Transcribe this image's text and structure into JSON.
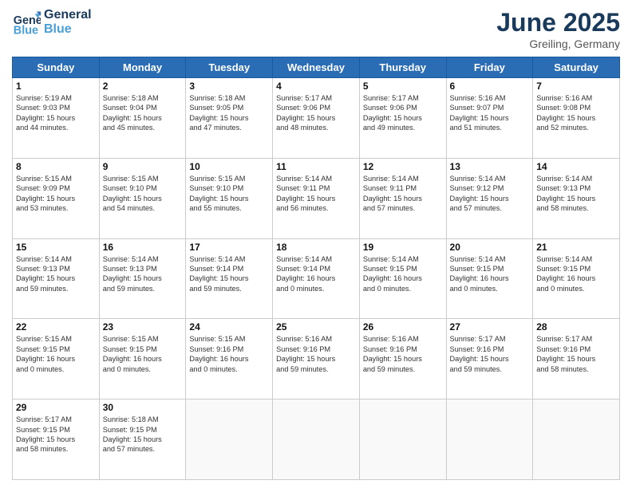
{
  "logo": {
    "line1": "General",
    "line2": "Blue"
  },
  "title": "June 2025",
  "location": "Greiling, Germany",
  "days_header": [
    "Sunday",
    "Monday",
    "Tuesday",
    "Wednesday",
    "Thursday",
    "Friday",
    "Saturday"
  ],
  "weeks": [
    [
      {
        "day": "1",
        "lines": [
          "Sunrise: 5:19 AM",
          "Sunset: 9:03 PM",
          "Daylight: 15 hours",
          "and 44 minutes."
        ]
      },
      {
        "day": "2",
        "lines": [
          "Sunrise: 5:18 AM",
          "Sunset: 9:04 PM",
          "Daylight: 15 hours",
          "and 45 minutes."
        ]
      },
      {
        "day": "3",
        "lines": [
          "Sunrise: 5:18 AM",
          "Sunset: 9:05 PM",
          "Daylight: 15 hours",
          "and 47 minutes."
        ]
      },
      {
        "day": "4",
        "lines": [
          "Sunrise: 5:17 AM",
          "Sunset: 9:06 PM",
          "Daylight: 15 hours",
          "and 48 minutes."
        ]
      },
      {
        "day": "5",
        "lines": [
          "Sunrise: 5:17 AM",
          "Sunset: 9:06 PM",
          "Daylight: 15 hours",
          "and 49 minutes."
        ]
      },
      {
        "day": "6",
        "lines": [
          "Sunrise: 5:16 AM",
          "Sunset: 9:07 PM",
          "Daylight: 15 hours",
          "and 51 minutes."
        ]
      },
      {
        "day": "7",
        "lines": [
          "Sunrise: 5:16 AM",
          "Sunset: 9:08 PM",
          "Daylight: 15 hours",
          "and 52 minutes."
        ]
      }
    ],
    [
      {
        "day": "8",
        "lines": [
          "Sunrise: 5:15 AM",
          "Sunset: 9:09 PM",
          "Daylight: 15 hours",
          "and 53 minutes."
        ]
      },
      {
        "day": "9",
        "lines": [
          "Sunrise: 5:15 AM",
          "Sunset: 9:10 PM",
          "Daylight: 15 hours",
          "and 54 minutes."
        ]
      },
      {
        "day": "10",
        "lines": [
          "Sunrise: 5:15 AM",
          "Sunset: 9:10 PM",
          "Daylight: 15 hours",
          "and 55 minutes."
        ]
      },
      {
        "day": "11",
        "lines": [
          "Sunrise: 5:14 AM",
          "Sunset: 9:11 PM",
          "Daylight: 15 hours",
          "and 56 minutes."
        ]
      },
      {
        "day": "12",
        "lines": [
          "Sunrise: 5:14 AM",
          "Sunset: 9:11 PM",
          "Daylight: 15 hours",
          "and 57 minutes."
        ]
      },
      {
        "day": "13",
        "lines": [
          "Sunrise: 5:14 AM",
          "Sunset: 9:12 PM",
          "Daylight: 15 hours",
          "and 57 minutes."
        ]
      },
      {
        "day": "14",
        "lines": [
          "Sunrise: 5:14 AM",
          "Sunset: 9:13 PM",
          "Daylight: 15 hours",
          "and 58 minutes."
        ]
      }
    ],
    [
      {
        "day": "15",
        "lines": [
          "Sunrise: 5:14 AM",
          "Sunset: 9:13 PM",
          "Daylight: 15 hours",
          "and 59 minutes."
        ]
      },
      {
        "day": "16",
        "lines": [
          "Sunrise: 5:14 AM",
          "Sunset: 9:13 PM",
          "Daylight: 15 hours",
          "and 59 minutes."
        ]
      },
      {
        "day": "17",
        "lines": [
          "Sunrise: 5:14 AM",
          "Sunset: 9:14 PM",
          "Daylight: 15 hours",
          "and 59 minutes."
        ]
      },
      {
        "day": "18",
        "lines": [
          "Sunrise: 5:14 AM",
          "Sunset: 9:14 PM",
          "Daylight: 16 hours",
          "and 0 minutes."
        ]
      },
      {
        "day": "19",
        "lines": [
          "Sunrise: 5:14 AM",
          "Sunset: 9:15 PM",
          "Daylight: 16 hours",
          "and 0 minutes."
        ]
      },
      {
        "day": "20",
        "lines": [
          "Sunrise: 5:14 AM",
          "Sunset: 9:15 PM",
          "Daylight: 16 hours",
          "and 0 minutes."
        ]
      },
      {
        "day": "21",
        "lines": [
          "Sunrise: 5:14 AM",
          "Sunset: 9:15 PM",
          "Daylight: 16 hours",
          "and 0 minutes."
        ]
      }
    ],
    [
      {
        "day": "22",
        "lines": [
          "Sunrise: 5:15 AM",
          "Sunset: 9:15 PM",
          "Daylight: 16 hours",
          "and 0 minutes."
        ]
      },
      {
        "day": "23",
        "lines": [
          "Sunrise: 5:15 AM",
          "Sunset: 9:15 PM",
          "Daylight: 16 hours",
          "and 0 minutes."
        ]
      },
      {
        "day": "24",
        "lines": [
          "Sunrise: 5:15 AM",
          "Sunset: 9:16 PM",
          "Daylight: 16 hours",
          "and 0 minutes."
        ]
      },
      {
        "day": "25",
        "lines": [
          "Sunrise: 5:16 AM",
          "Sunset: 9:16 PM",
          "Daylight: 15 hours",
          "and 59 minutes."
        ]
      },
      {
        "day": "26",
        "lines": [
          "Sunrise: 5:16 AM",
          "Sunset: 9:16 PM",
          "Daylight: 15 hours",
          "and 59 minutes."
        ]
      },
      {
        "day": "27",
        "lines": [
          "Sunrise: 5:17 AM",
          "Sunset: 9:16 PM",
          "Daylight: 15 hours",
          "and 59 minutes."
        ]
      },
      {
        "day": "28",
        "lines": [
          "Sunrise: 5:17 AM",
          "Sunset: 9:16 PM",
          "Daylight: 15 hours",
          "and 58 minutes."
        ]
      }
    ],
    [
      {
        "day": "29",
        "lines": [
          "Sunrise: 5:17 AM",
          "Sunset: 9:15 PM",
          "Daylight: 15 hours",
          "and 58 minutes."
        ]
      },
      {
        "day": "30",
        "lines": [
          "Sunrise: 5:18 AM",
          "Sunset: 9:15 PM",
          "Daylight: 15 hours",
          "and 57 minutes."
        ]
      },
      null,
      null,
      null,
      null,
      null
    ]
  ]
}
